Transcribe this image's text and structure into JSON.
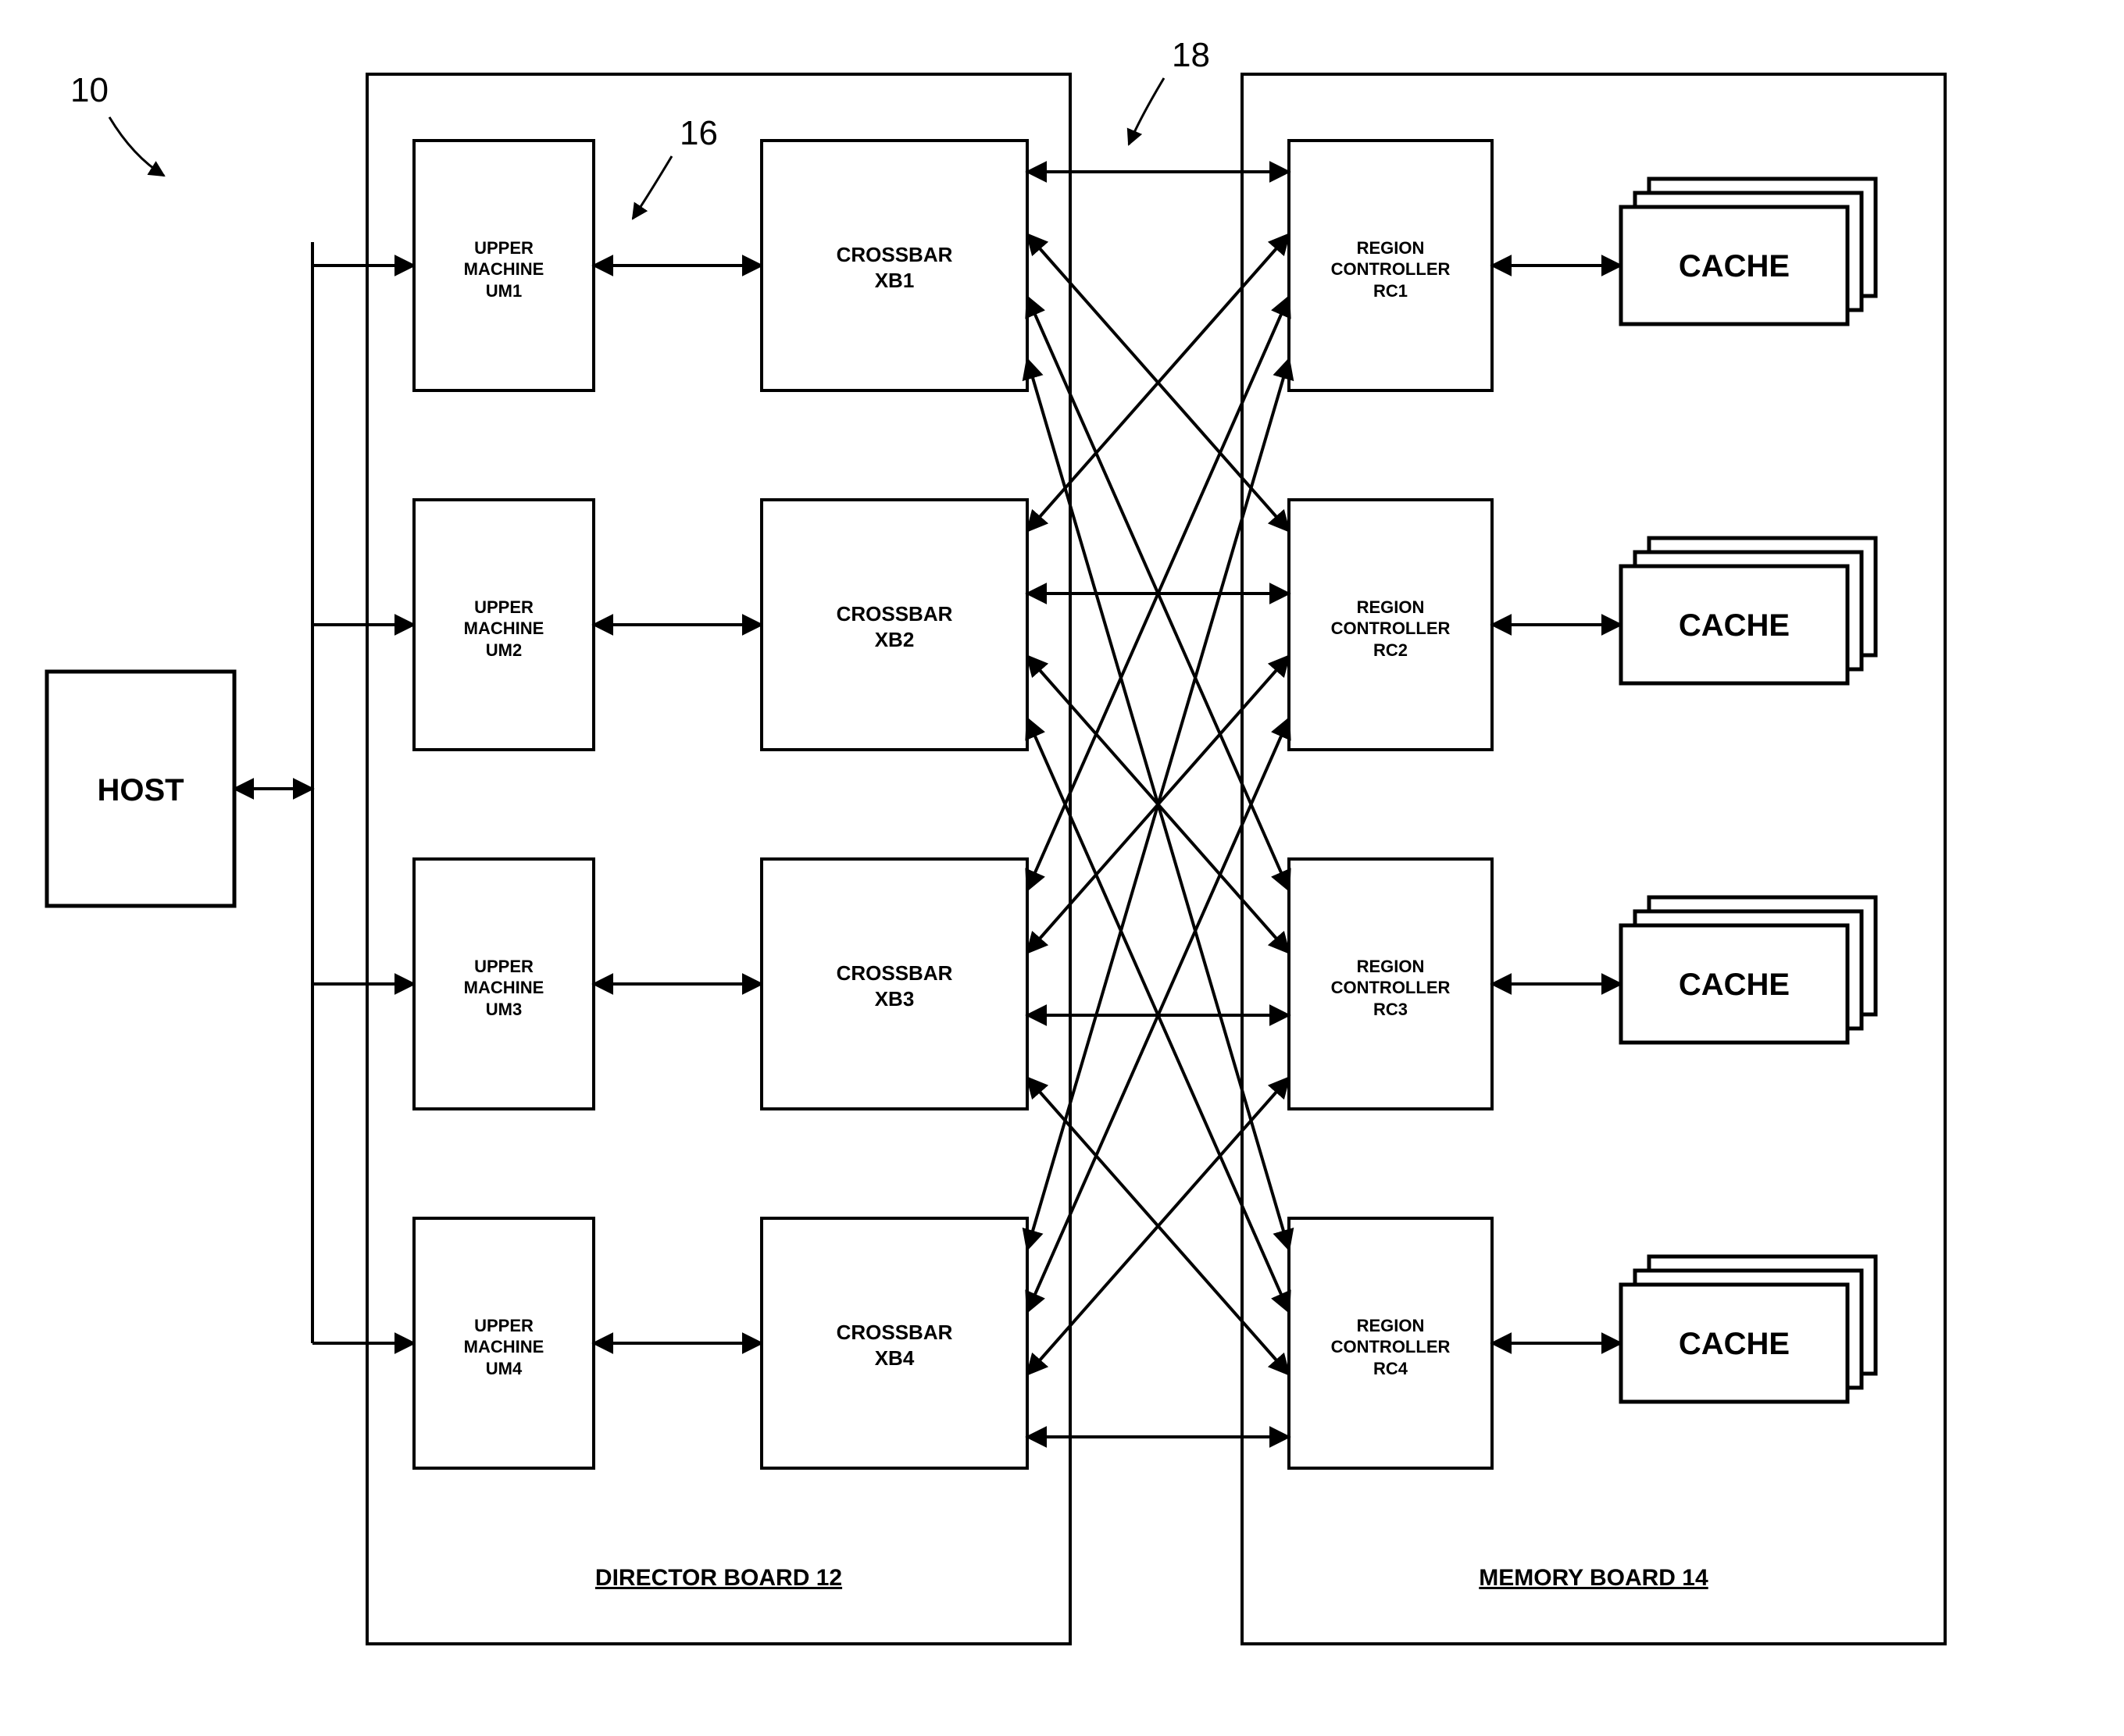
{
  "refs": {
    "system": "10",
    "um_xb": "16",
    "xb_rc": "18"
  },
  "host": {
    "label": "HOST"
  },
  "director_board": {
    "title": "DIRECTOR BOARD 12",
    "upper_machines": [
      {
        "l1": "UPPER",
        "l2": "MACHINE",
        "l3": "UM1"
      },
      {
        "l1": "UPPER",
        "l2": "MACHINE",
        "l3": "UM2"
      },
      {
        "l1": "UPPER",
        "l2": "MACHINE",
        "l3": "UM3"
      },
      {
        "l1": "UPPER",
        "l2": "MACHINE",
        "l3": "UM4"
      }
    ],
    "crossbars": [
      {
        "l1": "CROSSBAR",
        "l2": "XB1"
      },
      {
        "l1": "CROSSBAR",
        "l2": "XB2"
      },
      {
        "l1": "CROSSBAR",
        "l2": "XB3"
      },
      {
        "l1": "CROSSBAR",
        "l2": "XB4"
      }
    ]
  },
  "memory_board": {
    "title": "MEMORY BOARD 14",
    "region_controllers": [
      {
        "l1": "REGION",
        "l2": "CONTROLLER",
        "l3": "RC1"
      },
      {
        "l1": "REGION",
        "l2": "CONTROLLER",
        "l3": "RC2"
      },
      {
        "l1": "REGION",
        "l2": "CONTROLLER",
        "l3": "RC3"
      },
      {
        "l1": "REGION",
        "l2": "CONTROLLER",
        "l3": "RC4"
      }
    ],
    "cache_label": "CACHE"
  }
}
